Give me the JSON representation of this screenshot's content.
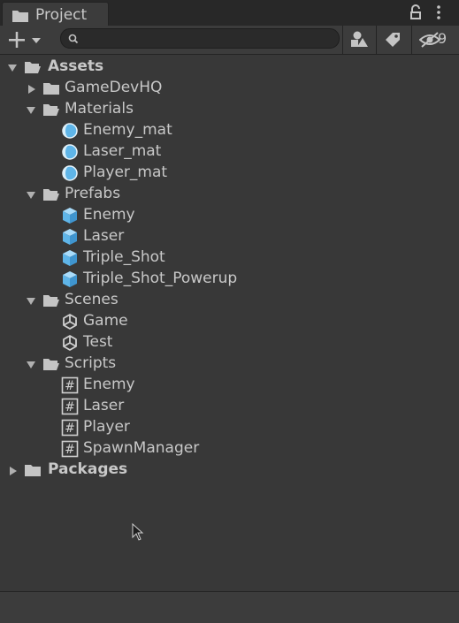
{
  "window": {
    "tab_label": "Project"
  },
  "toolbar": {
    "add_icon": "plus-icon",
    "search_placeholder": "",
    "hidden_count": "9"
  },
  "tree": {
    "assets": "Assets",
    "gamedevhq": "GameDevHQ",
    "materials": "Materials",
    "materials_items": [
      "Enemy_mat",
      "Laser_mat",
      "Player_mat"
    ],
    "prefabs": "Prefabs",
    "prefabs_items": [
      "Enemy",
      "Laser",
      "Triple_Shot",
      "Triple_Shot_Powerup"
    ],
    "scenes": "Scenes",
    "scenes_items": [
      "Game",
      "Test"
    ],
    "scripts": "Scripts",
    "scripts_items": [
      "Enemy",
      "Laser",
      "Player",
      "SpawnManager"
    ],
    "packages": "Packages"
  },
  "colors": {
    "background": "#383838",
    "tabbar": "#282828",
    "accent_blue": "#5fb5e8"
  }
}
